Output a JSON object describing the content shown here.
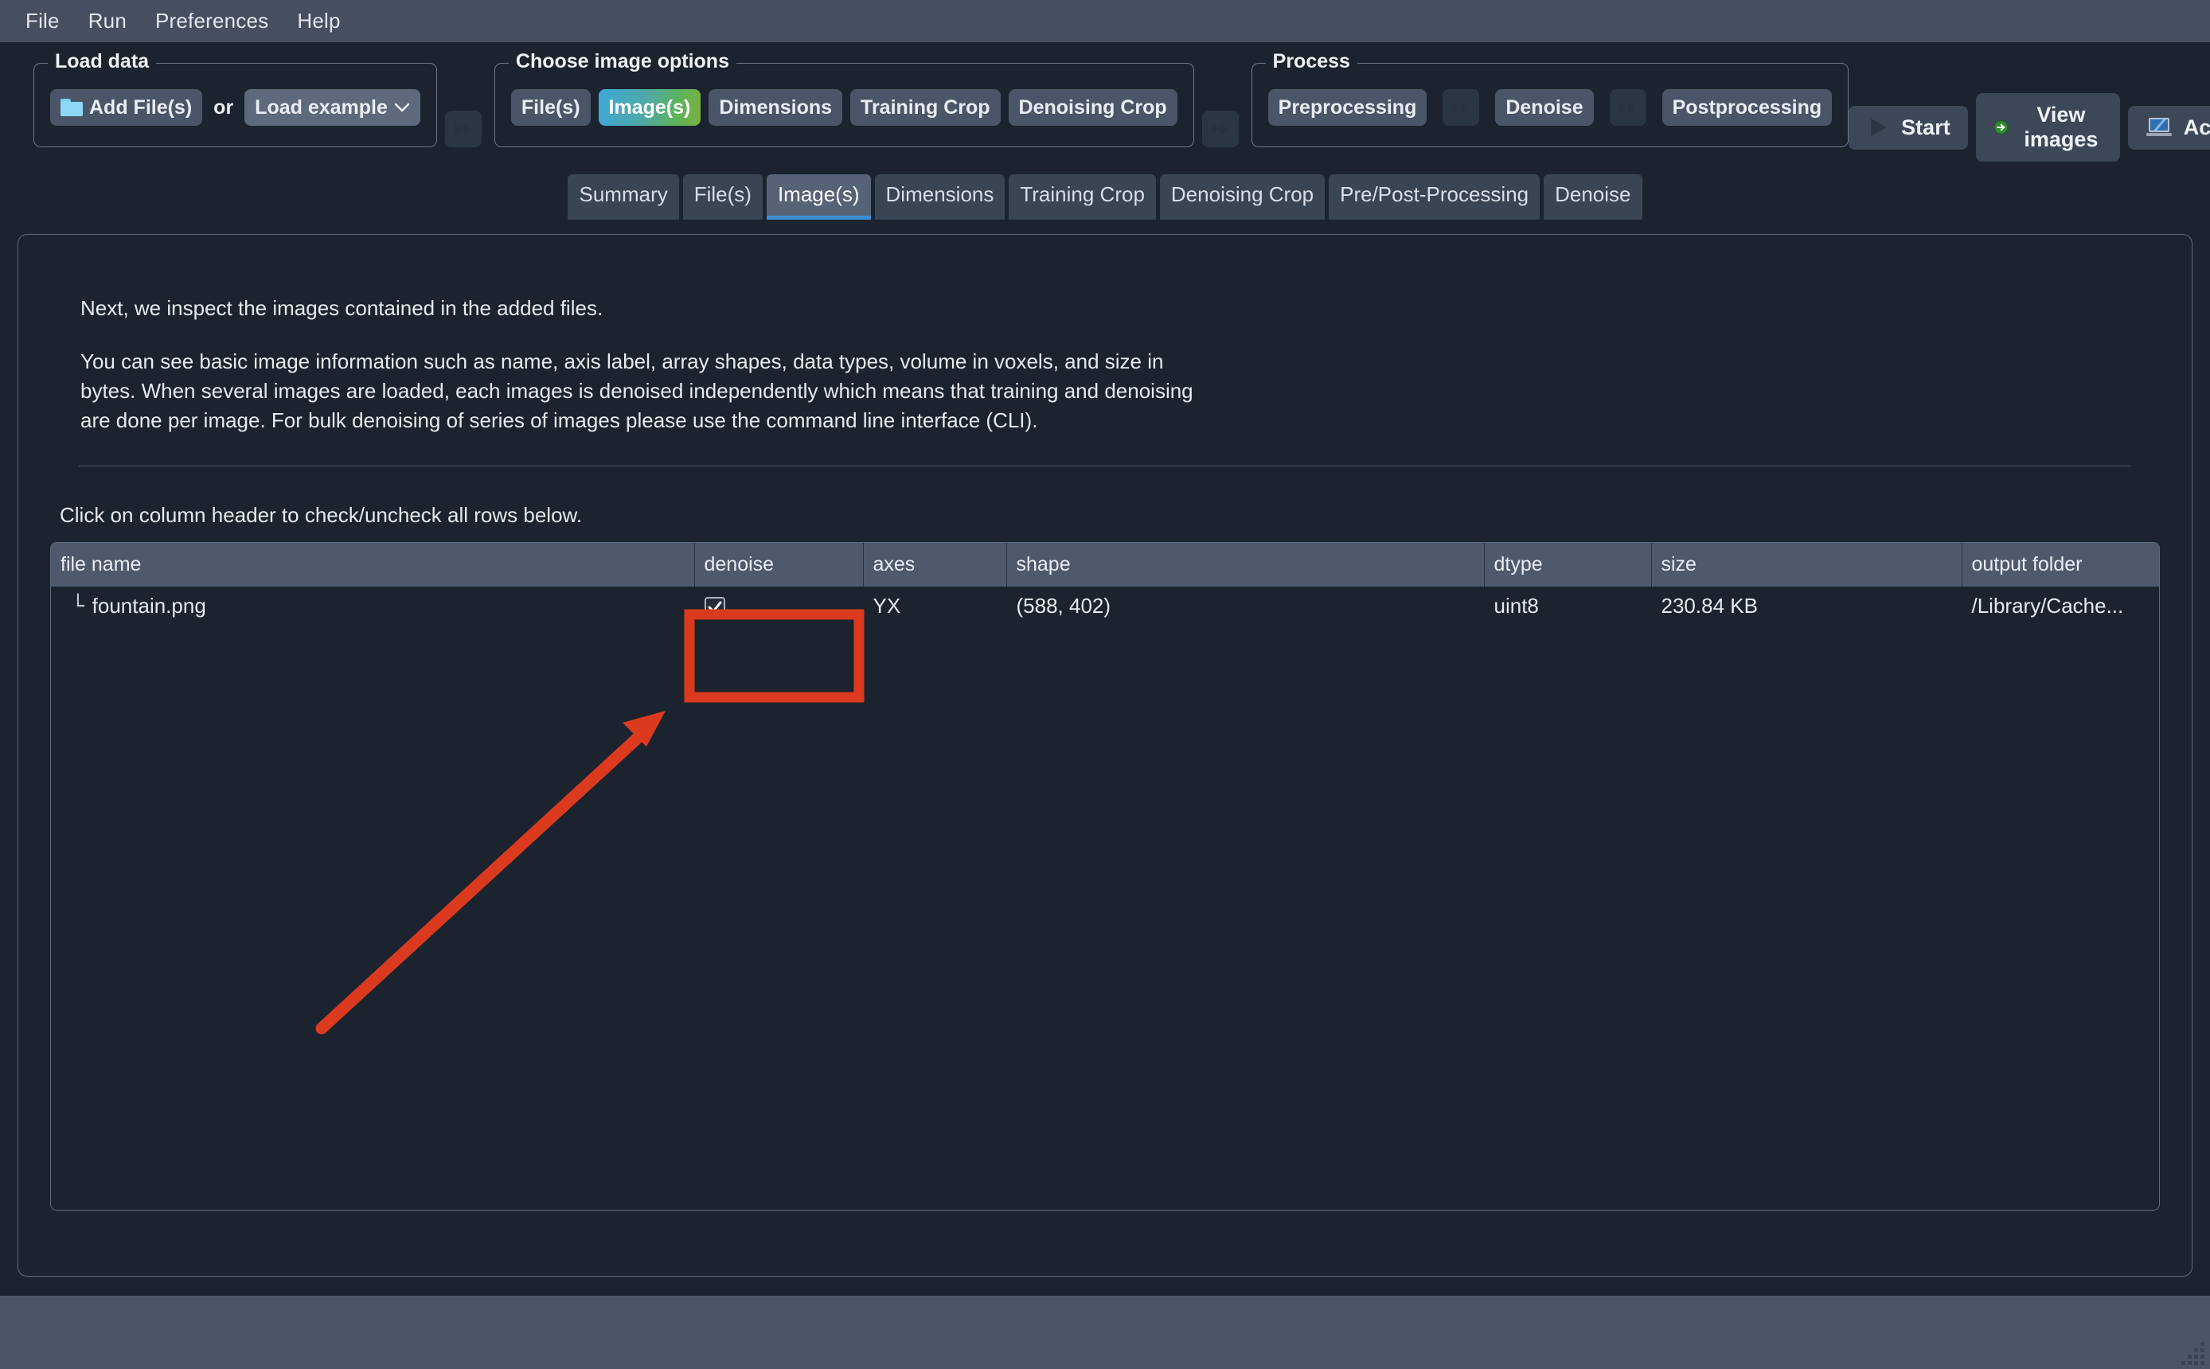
{
  "menubar": {
    "items": [
      {
        "label": "File"
      },
      {
        "label": "Run"
      },
      {
        "label": "Preferences"
      },
      {
        "label": "Help"
      }
    ]
  },
  "toolbar": {
    "groups": [
      {
        "title": "Load data",
        "add_files_label": "Add File(s)",
        "or_label": "or",
        "load_example_label": "Load example"
      },
      {
        "title": "Choose image options",
        "buttons": [
          {
            "label": "File(s)",
            "active": false
          },
          {
            "label": "Image(s)",
            "active": true
          },
          {
            "label": "Dimensions",
            "active": false
          },
          {
            "label": "Training Crop",
            "active": false
          },
          {
            "label": "Denoising Crop",
            "active": false
          }
        ]
      },
      {
        "title": "Process",
        "buttons": [
          {
            "label": "Preprocessing"
          },
          {
            "label": "Denoise"
          },
          {
            "label": "Postprocessing"
          }
        ]
      }
    ],
    "actions": [
      {
        "label": "Start",
        "icon": "play-icon"
      },
      {
        "label": "View images",
        "icon": "green-arrow-icon"
      },
      {
        "label": "Activity",
        "icon": "laptop-icon"
      }
    ]
  },
  "tabs": [
    {
      "label": "Summary",
      "active": false
    },
    {
      "label": "File(s)",
      "active": false
    },
    {
      "label": "Image(s)",
      "active": true
    },
    {
      "label": "Dimensions",
      "active": false
    },
    {
      "label": "Training Crop",
      "active": false
    },
    {
      "label": "Denoising Crop",
      "active": false
    },
    {
      "label": "Pre/Post-Processing",
      "active": false
    },
    {
      "label": "Denoise",
      "active": false
    }
  ],
  "content": {
    "paragraph1": "Next, we inspect the images contained in the added files.",
    "paragraph2": "You can see basic image information such as name, axis label, array shapes, data types, volume in voxels, and size in bytes. When several images are loaded, each images is denoised independently which means that training and denoising are done per image. For bulk denoising of series of images please use the command line interface (CLI).",
    "hint": "Click on column header to check/uncheck all rows below."
  },
  "table": {
    "columns": [
      {
        "key": "file_name",
        "label": "file name"
      },
      {
        "key": "denoise",
        "label": "denoise"
      },
      {
        "key": "axes",
        "label": "axes"
      },
      {
        "key": "shape",
        "label": "shape"
      },
      {
        "key": "dtype",
        "label": "dtype"
      },
      {
        "key": "size",
        "label": "size"
      },
      {
        "key": "output_folder",
        "label": "output folder"
      }
    ],
    "rows": [
      {
        "file_name": "fountain.png",
        "tree_glyph": "└",
        "denoise_checked": true,
        "axes": "YX",
        "shape": "(588, 402)",
        "dtype": "uint8",
        "size": "230.84 KB",
        "output_folder": "/Library/Cache..."
      }
    ]
  },
  "annotation": {
    "highlight_color": "#dc3a1e",
    "box_label": "denoise-column-highlight",
    "arrow_label": "pointer-arrow"
  },
  "colors": {
    "menubar_bg": "#454f5f",
    "app_bg": "#1b242e",
    "button_bg": "#4a5668",
    "table_header_bg": "#4e5a6c",
    "tab_active_bg": "#566276",
    "tab_active_underline": "#3d8fd4",
    "statusbar_bg": "#4a5668"
  }
}
